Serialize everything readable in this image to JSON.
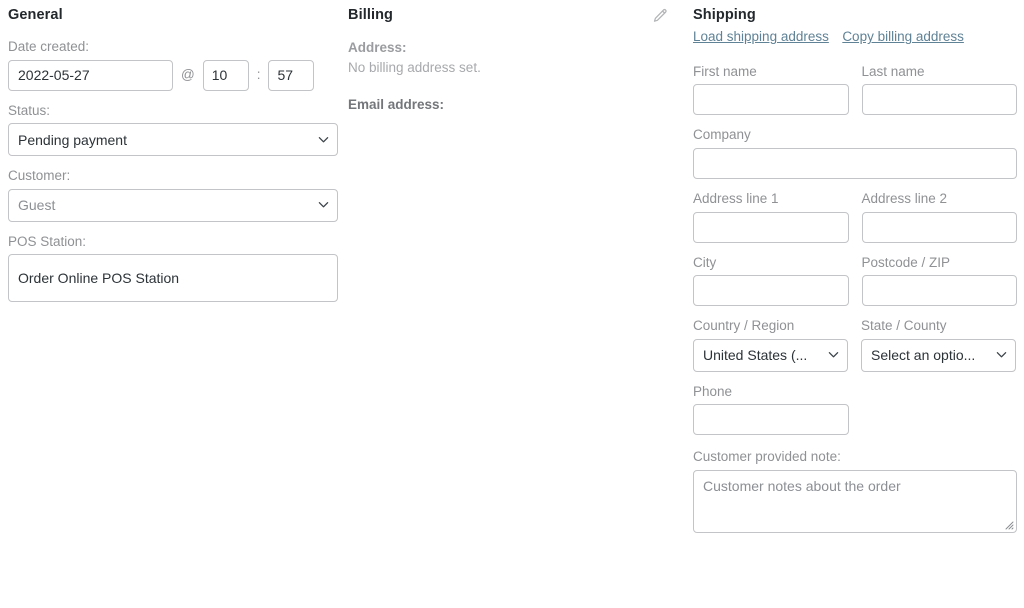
{
  "general": {
    "title": "General",
    "date_label": "Date created:",
    "date_value": "2022-05-27",
    "at_symbol": "@",
    "hour_value": "10",
    "time_separator": ":",
    "minute_value": "57",
    "status_label": "Status:",
    "status_value": "Pending payment",
    "customer_label": "Customer:",
    "customer_value": "Guest",
    "pos_label": "POS Station:",
    "pos_value": "Order Online POS Station"
  },
  "billing": {
    "title": "Billing",
    "edit_icon": "pencil-icon",
    "address_label": "Address:",
    "address_value": "No billing address set.",
    "email_label": "Email address:"
  },
  "shipping": {
    "title": "Shipping",
    "load_link": "Load shipping address",
    "copy_link": "Copy billing address",
    "first_name_label": "First name",
    "first_name_value": "",
    "last_name_label": "Last name",
    "last_name_value": "",
    "company_label": "Company",
    "company_value": "",
    "address1_label": "Address line 1",
    "address1_value": "",
    "address2_label": "Address line 2",
    "address2_value": "",
    "city_label": "City",
    "city_value": "",
    "postcode_label": "Postcode / ZIP",
    "postcode_value": "",
    "country_label": "Country / Region",
    "country_value": "United States (...",
    "state_label": "State / County",
    "state_value": "Select an optio...",
    "phone_label": "Phone",
    "phone_value": "",
    "note_label": "Customer provided note:",
    "note_placeholder": "Customer notes about the order",
    "note_value": "",
    "resize_handle": "resize-grip-icon"
  },
  "colors": {
    "link": "#5f8296",
    "border": "#c3c4c7",
    "label": "#8f9194",
    "heading": "#23282d",
    "text": "#2c3338",
    "placeholder": "#8c8f94"
  }
}
